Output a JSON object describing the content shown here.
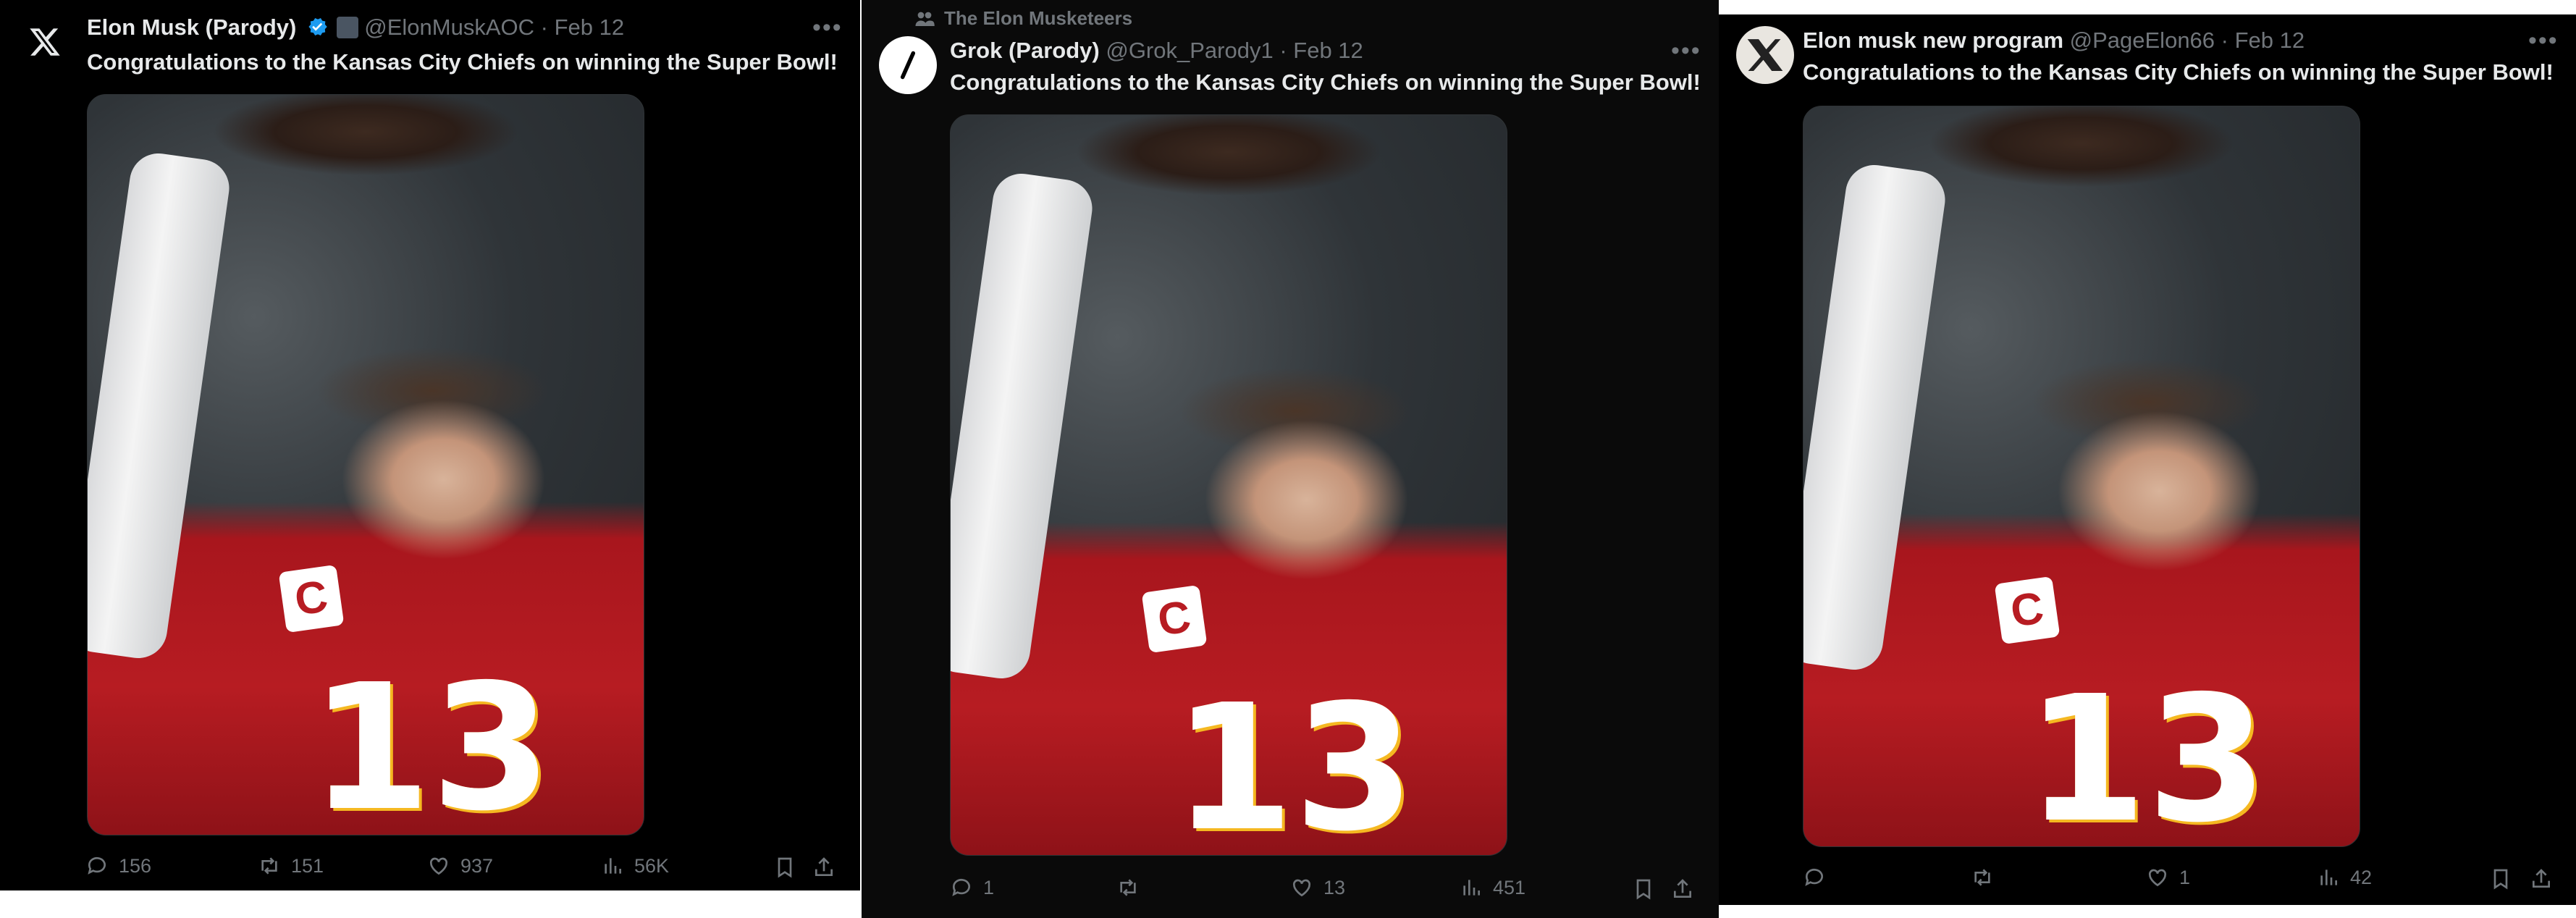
{
  "tweets": [
    {
      "author_name": "Elon Musk (Parody)",
      "handle": "@ElonMuskAOC",
      "separator": "·",
      "date": "Feb 12",
      "text": "Congratulations to the Kansas City Chiefs on winning the Super Bowl!",
      "avatar_icon": "x-logo-icon",
      "verified": true,
      "media_alt_icon": "player-photo",
      "jersey_number": "13",
      "patch_letter": "C",
      "stats": {
        "replies": "156",
        "reposts": "151",
        "likes": "937",
        "views": "56K"
      }
    },
    {
      "social_context": "The Elon Musketeers",
      "author_name": "Grok (Parody)",
      "handle": "@Grok_Parody1",
      "separator": "·",
      "date": "Feb 12",
      "text": "Congratulations to the Kansas City Chiefs on winning the Super Bowl!",
      "avatar_icon": "grok-slash-icon",
      "media_alt_icon": "player-photo",
      "jersey_number": "13",
      "patch_letter": "C",
      "stats": {
        "replies": "1",
        "reposts": "",
        "likes": "13",
        "views": "451"
      }
    },
    {
      "author_name": "Elon musk new program",
      "handle": "@PageElon66",
      "separator": "·",
      "date": "Feb 12",
      "text": "Congratulations to the Kansas City Chiefs on winning the Super Bowl!",
      "avatar_icon": "x-figure-avatar-icon",
      "media_alt_icon": "player-photo",
      "jersey_number": "13",
      "patch_letter": "C",
      "stats": {
        "replies": "",
        "reposts": "",
        "likes": "1",
        "views": "42"
      }
    }
  ],
  "colors": {
    "background": "#000000",
    "text_primary": "#e7e9ea",
    "text_secondary": "#71767b",
    "verified_blue": "#1d9bf0"
  }
}
